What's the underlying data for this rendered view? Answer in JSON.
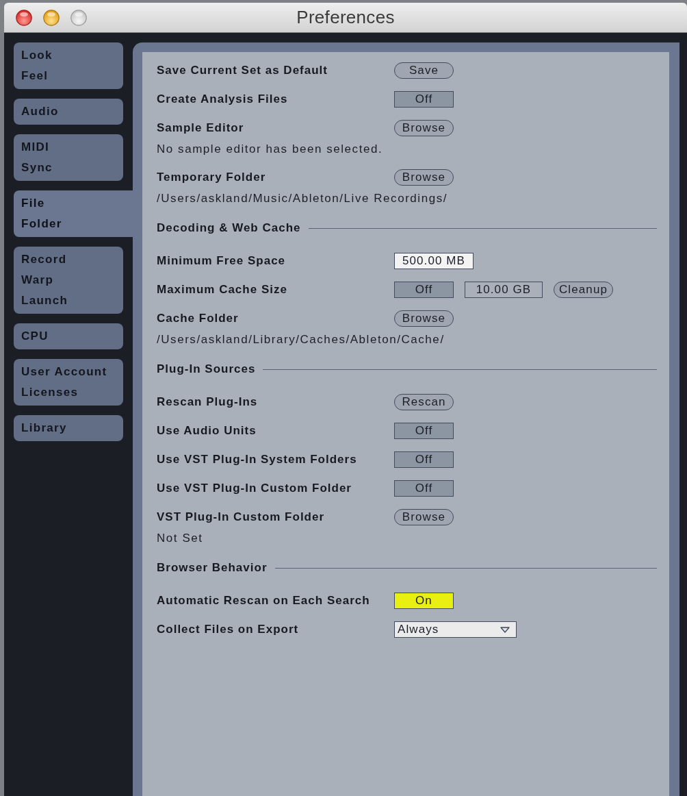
{
  "window": {
    "title": "Preferences"
  },
  "sidebar": {
    "tabs": [
      {
        "lines": [
          "Look",
          "Feel"
        ],
        "selected": false
      },
      {
        "lines": [
          "Audio"
        ],
        "selected": false
      },
      {
        "lines": [
          "MIDI",
          "Sync"
        ],
        "selected": false
      },
      {
        "lines": [
          "File",
          "Folder"
        ],
        "selected": true
      },
      {
        "lines": [
          "Record",
          "Warp",
          "Launch"
        ],
        "selected": false
      },
      {
        "lines": [
          "CPU"
        ],
        "selected": false
      },
      {
        "lines": [
          "User Account",
          "Licenses"
        ],
        "selected": false
      },
      {
        "lines": [
          "Library"
        ],
        "selected": false
      }
    ]
  },
  "settings": [
    {
      "kind": "setting",
      "label": "Save Current Set as Default",
      "controls": [
        {
          "kind": "button",
          "text": "Save"
        }
      ]
    },
    {
      "kind": "setting",
      "label": "Create Analysis Files",
      "controls": [
        {
          "kind": "toggle",
          "text": "Off",
          "on": false
        }
      ]
    },
    {
      "kind": "setting",
      "label": "Sample Editor",
      "controls": [
        {
          "kind": "button",
          "text": "Browse"
        }
      ]
    },
    {
      "kind": "note",
      "text": "No sample editor has been selected."
    },
    {
      "kind": "setting",
      "label": "Temporary Folder",
      "controls": [
        {
          "kind": "button",
          "text": "Browse"
        }
      ]
    },
    {
      "kind": "note",
      "text": "/Users/askland/Music/Ableton/Live Recordings/"
    },
    {
      "kind": "section",
      "title": "Decoding & Web Cache"
    },
    {
      "kind": "setting",
      "label": "Minimum Free Space",
      "controls": [
        {
          "kind": "field",
          "value": "500.00 MB",
          "disabled": false
        }
      ]
    },
    {
      "kind": "setting",
      "label": "Maximum Cache Size",
      "controls": [
        {
          "kind": "toggle",
          "text": "Off",
          "on": false
        },
        {
          "kind": "field",
          "value": "10.00 GB",
          "disabled": true
        },
        {
          "kind": "button",
          "text": "Cleanup"
        }
      ]
    },
    {
      "kind": "setting",
      "label": "Cache Folder",
      "controls": [
        {
          "kind": "button",
          "text": "Browse"
        }
      ]
    },
    {
      "kind": "note",
      "text": "/Users/askland/Library/Caches/Ableton/Cache/"
    },
    {
      "kind": "section",
      "title": "Plug-In Sources"
    },
    {
      "kind": "setting",
      "label": "Rescan Plug-Ins",
      "controls": [
        {
          "kind": "button",
          "text": "Rescan"
        }
      ]
    },
    {
      "kind": "setting",
      "label": "Use Audio Units",
      "controls": [
        {
          "kind": "toggle",
          "text": "Off",
          "on": false
        }
      ]
    },
    {
      "kind": "setting",
      "label": "Use VST Plug-In System Folders",
      "controls": [
        {
          "kind": "toggle",
          "text": "Off",
          "on": false
        }
      ]
    },
    {
      "kind": "setting",
      "label": "Use VST Plug-In Custom Folder",
      "controls": [
        {
          "kind": "toggle",
          "text": "Off",
          "on": false
        }
      ]
    },
    {
      "kind": "setting",
      "label": "VST Plug-In Custom Folder",
      "controls": [
        {
          "kind": "button",
          "text": "Browse"
        }
      ]
    },
    {
      "kind": "note",
      "text": "Not Set"
    },
    {
      "kind": "section",
      "title": "Browser Behavior"
    },
    {
      "kind": "setting",
      "label": "Automatic Rescan on Each Search",
      "controls": [
        {
          "kind": "toggle",
          "text": "On",
          "on": true
        }
      ]
    },
    {
      "kind": "setting",
      "label": "Collect Files on Export",
      "controls": [
        {
          "kind": "dropdown",
          "value": "Always"
        }
      ]
    }
  ]
}
